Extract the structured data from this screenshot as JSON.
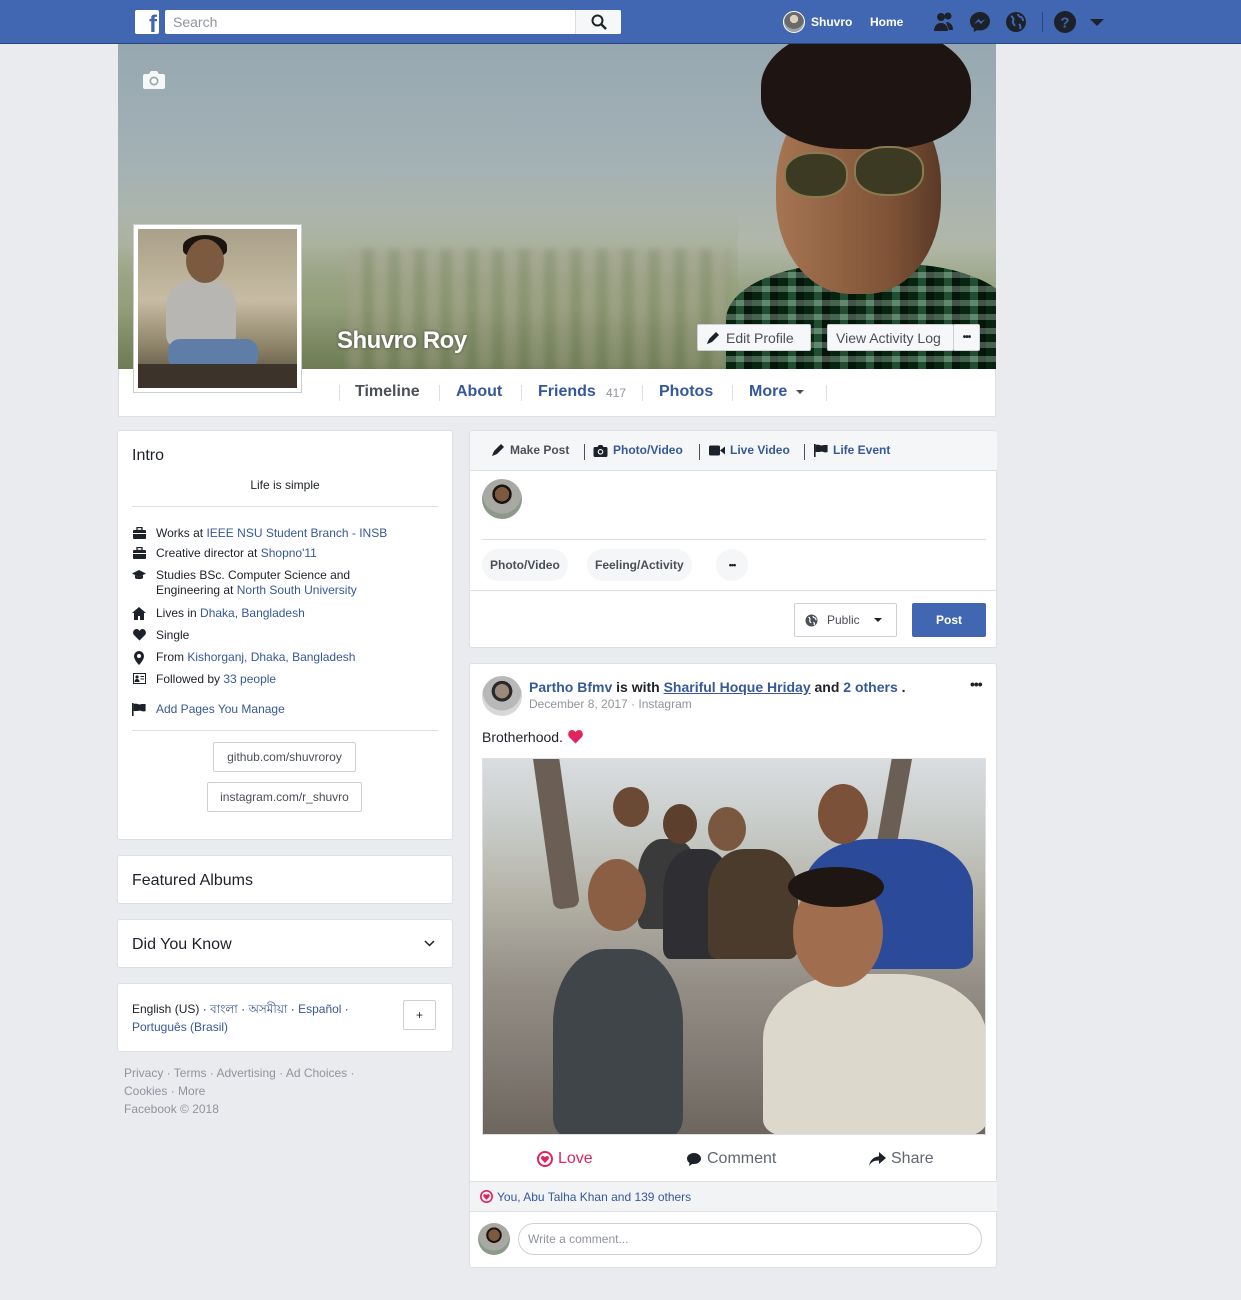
{
  "topbar": {
    "search_placeholder": "Search",
    "user_name": "Shuvro",
    "home_label": "Home"
  },
  "profile": {
    "name": "Shuvro Roy",
    "edit_profile_label": "Edit Profile",
    "activity_log_label": "View Activity Log",
    "more_dots": "•••"
  },
  "nav": {
    "timeline": "Timeline",
    "about": "About",
    "friends": "Friends",
    "friends_count": "417",
    "photos": "Photos",
    "more": "More"
  },
  "intro": {
    "title": "Intro",
    "bio": "Life is simple",
    "rows": [
      {
        "icon": "briefcase-icon",
        "pre": "Works at ",
        "link": "IEEE NSU Student Branch - INSB",
        "post": ""
      },
      {
        "icon": "briefcase-icon",
        "pre": "Creative director at ",
        "link": "Shopno'11",
        "post": ""
      },
      {
        "icon": "graduation-cap-icon",
        "pre": "Studies BSc. Computer Science and Engineering at ",
        "link": "North South University",
        "post": ""
      },
      {
        "icon": "home-icon",
        "pre": "Lives in ",
        "link": "Dhaka, Bangladesh",
        "post": ""
      },
      {
        "icon": "heart-icon",
        "pre": "Single",
        "link": "",
        "post": ""
      },
      {
        "icon": "map-pin-icon",
        "pre": "From ",
        "link": "Kishorganj, Dhaka, Bangladesh",
        "post": ""
      },
      {
        "icon": "followers-icon",
        "pre": "Followed by ",
        "link": "33 people",
        "post": ""
      }
    ],
    "add_pages": "Add Pages You Manage",
    "links": [
      "github.com/shuvroroy",
      "instagram.com/r_shuvro"
    ]
  },
  "featured_albums": {
    "title": "Featured Albums"
  },
  "did_you_know": {
    "title": "Did You Know"
  },
  "languages": {
    "current": "English (US)",
    "others": [
      "বাংলা",
      "অসমীয়া",
      "Español",
      "Português (Brasil)"
    ],
    "sep": " · ",
    "plus": "+"
  },
  "footer": {
    "line1": "Privacy · Terms · Advertising · Ad Choices ·",
    "line2": "Cookies · More",
    "line3": "Facebook © 2018"
  },
  "composer": {
    "tabs": [
      "Make Post",
      "Photo/Video",
      "Live Video",
      "Life Event"
    ],
    "pills": [
      "Photo/Video",
      "Feeling/Activity"
    ],
    "more_dots": "•••",
    "privacy": "Public",
    "post_label": "Post"
  },
  "post": {
    "author": "Partho Bfmv",
    "is_with": " is with ",
    "tagged": "Shariful Hoque Hriday",
    "and": " and ",
    "others": "2 others",
    "period": " .",
    "meta": "December 8, 2017 · Instagram",
    "text": "Brotherhood.",
    "dots": "•••",
    "love_label": "Love",
    "comment_label": "Comment",
    "share_label": "Share",
    "reactions": "You, Abu Talha Khan and 139 others",
    "comment_placeholder": "Write a comment..."
  },
  "colors": {
    "brand": "#4267b2",
    "link": "#365899",
    "love": "#e0245e",
    "background": "#e9ebee"
  }
}
